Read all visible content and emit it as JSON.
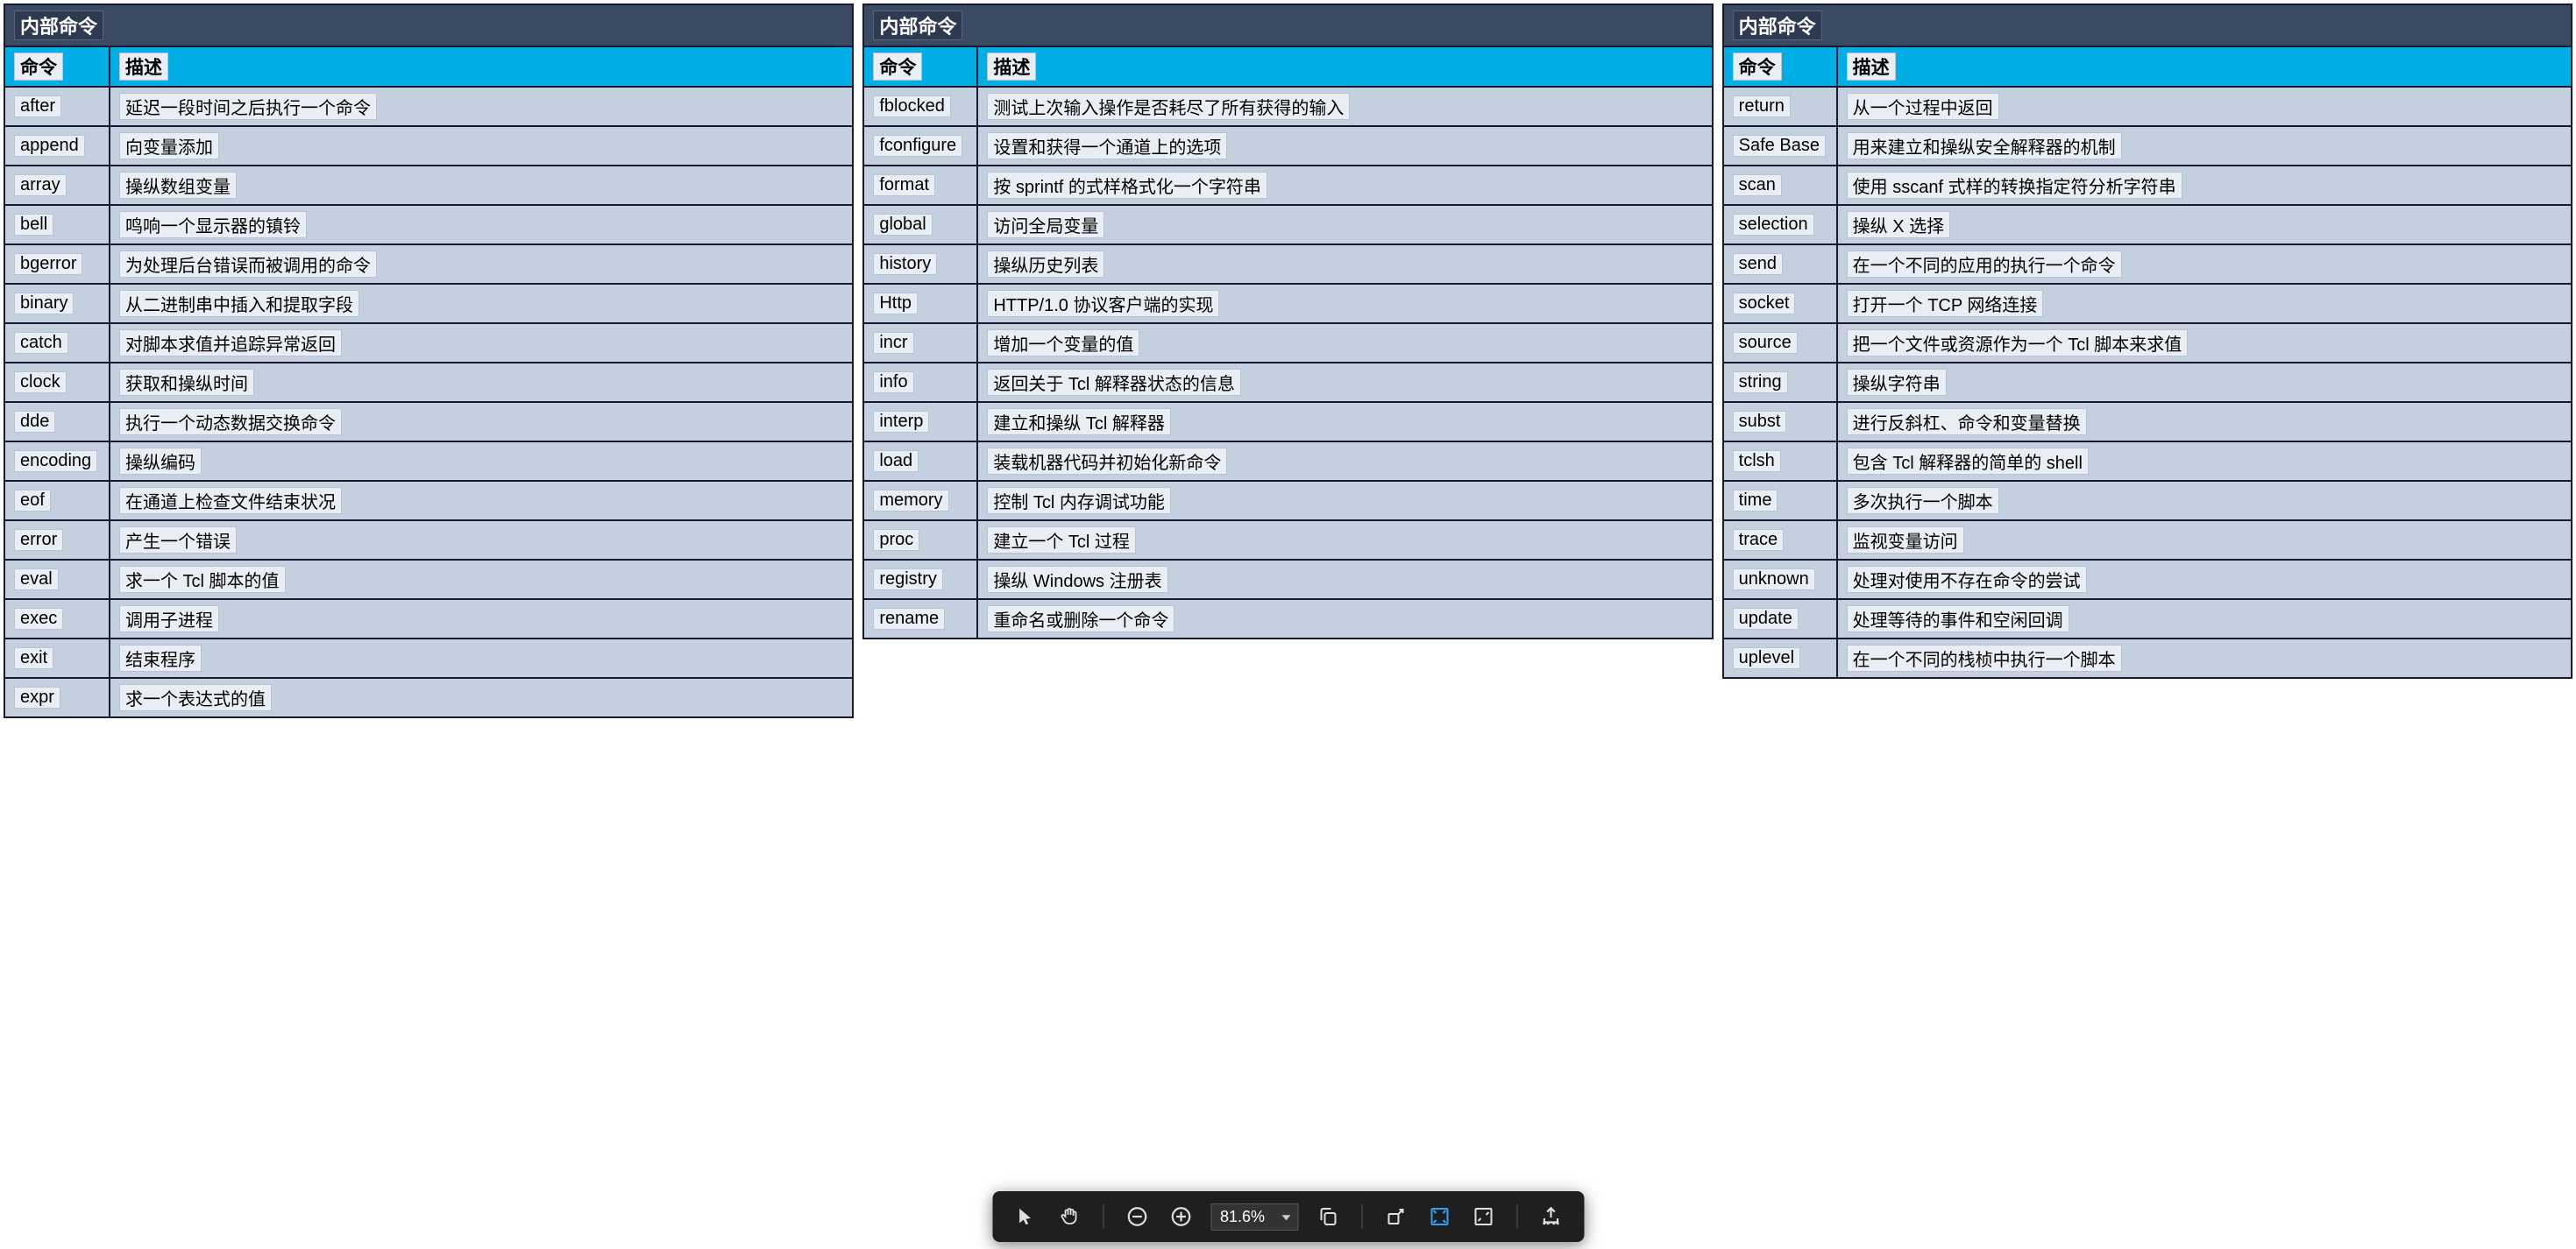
{
  "tables": [
    {
      "title": "内部命令",
      "headers": {
        "cmd": "命令",
        "desc": "描述"
      },
      "rows": [
        {
          "cmd": "after",
          "desc": "延迟一段时间之后执行一个命令"
        },
        {
          "cmd": "append",
          "desc": "向变量添加"
        },
        {
          "cmd": "array",
          "desc": "操纵数组变量"
        },
        {
          "cmd": "bell",
          "desc": "鸣响一个显示器的镇铃"
        },
        {
          "cmd": "bgerror",
          "desc": "为处理后台错误而被调用的命令"
        },
        {
          "cmd": "binary",
          "desc": "从二进制串中插入和提取字段"
        },
        {
          "cmd": "catch",
          "desc": "对脚本求值并追踪异常返回"
        },
        {
          "cmd": "clock",
          "desc": "获取和操纵时间"
        },
        {
          "cmd": "dde",
          "desc": "执行一个动态数据交换命令"
        },
        {
          "cmd": "encoding",
          "desc": "操纵编码"
        },
        {
          "cmd": "eof",
          "desc": "在通道上检查文件结束状况"
        },
        {
          "cmd": "error",
          "desc": "产生一个错误"
        },
        {
          "cmd": "eval",
          "desc": "求一个 Tcl 脚本的值"
        },
        {
          "cmd": "exec",
          "desc": "调用子进程"
        },
        {
          "cmd": "exit",
          "desc": "结束程序"
        },
        {
          "cmd": "expr",
          "desc": "求一个表达式的值"
        }
      ]
    },
    {
      "title": "内部命令",
      "headers": {
        "cmd": "命令",
        "desc": "描述"
      },
      "rows": [
        {
          "cmd": "fblocked",
          "desc": "测试上次输入操作是否耗尽了所有获得的输入"
        },
        {
          "cmd": "fconfigure",
          "desc": "设置和获得一个通道上的选项"
        },
        {
          "cmd": "format",
          "desc": "按 sprintf 的式样格式化一个字符串"
        },
        {
          "cmd": "global",
          "desc": "访问全局变量"
        },
        {
          "cmd": "history",
          "desc": "操纵历史列表"
        },
        {
          "cmd": "Http",
          "desc": "HTTP/1.0 协议客户端的实现"
        },
        {
          "cmd": "incr",
          "desc": "增加一个变量的值"
        },
        {
          "cmd": "info",
          "desc": "返回关于 Tcl 解释器状态的信息"
        },
        {
          "cmd": "interp",
          "desc": "建立和操纵 Tcl 解释器"
        },
        {
          "cmd": "load",
          "desc": "装载机器代码并初始化新命令"
        },
        {
          "cmd": "memory",
          "desc": "控制 Tcl 内存调试功能"
        },
        {
          "cmd": "proc",
          "desc": "建立一个 Tcl 过程"
        },
        {
          "cmd": "registry",
          "desc": "操纵 Windows 注册表"
        },
        {
          "cmd": "rename",
          "desc": "重命名或删除一个命令"
        }
      ]
    },
    {
      "title": "内部命令",
      "headers": {
        "cmd": "命令",
        "desc": "描述"
      },
      "rows": [
        {
          "cmd": "return",
          "desc": "从一个过程中返回"
        },
        {
          "cmd": "Safe Base",
          "desc": "用来建立和操纵安全解释器的机制"
        },
        {
          "cmd": "scan",
          "desc": "使用 sscanf 式样的转换指定符分析字符串"
        },
        {
          "cmd": "selection",
          "desc": "操纵 X 选择"
        },
        {
          "cmd": "send",
          "desc": "在一个不同的应用的执行一个命令"
        },
        {
          "cmd": "socket",
          "desc": "打开一个 TCP 网络连接"
        },
        {
          "cmd": "source",
          "desc": "把一个文件或资源作为一个 Tcl 脚本来求值"
        },
        {
          "cmd": "string",
          "desc": "操纵字符串"
        },
        {
          "cmd": "subst",
          "desc": "进行反斜杠、命令和变量替换"
        },
        {
          "cmd": "tclsh",
          "desc": "包含 Tcl 解释器的简单的 shell"
        },
        {
          "cmd": "time",
          "desc": "多次执行一个脚本"
        },
        {
          "cmd": "trace",
          "desc": "监视变量访问"
        },
        {
          "cmd": "unknown",
          "desc": "处理对使用不存在命令的尝试"
        },
        {
          "cmd": "update",
          "desc": "处理等待的事件和空闲回调"
        },
        {
          "cmd": "uplevel",
          "desc": "在一个不同的栈桢中执行一个脚本"
        }
      ]
    }
  ],
  "toolbar": {
    "zoom_value": "81.6%"
  }
}
